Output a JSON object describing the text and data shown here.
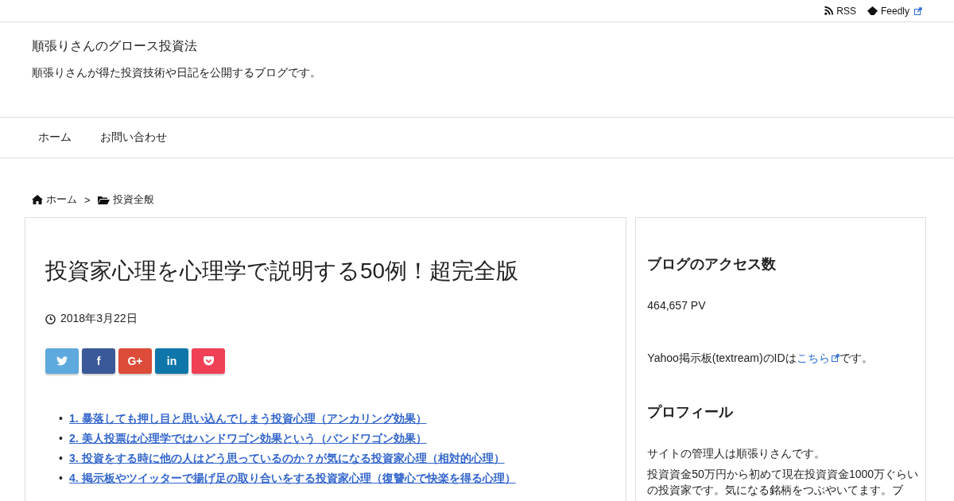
{
  "top_links": [
    {
      "kind": "rss",
      "label": "RSS",
      "external": false
    },
    {
      "kind": "feedly",
      "label": "Feedly",
      "external": true
    }
  ],
  "site": {
    "title": "順張りさんのグロース投資法",
    "tagline": "順張りさんが得た投資技術や日記を公開するブログです。"
  },
  "nav": [
    "ホーム",
    "お問い合わせ"
  ],
  "breadcrumb": [
    {
      "kind": "home",
      "label": "ホーム"
    },
    {
      "kind": "folder",
      "label": "投資全般"
    }
  ],
  "breadcrumb_separator": ">",
  "article": {
    "title": "投資家心理を心理学で説明する50例！超完全版",
    "date": "2018年3月22日",
    "share": [
      {
        "kind": "twitter",
        "color": "#5ea9dd"
      },
      {
        "kind": "text",
        "label": "f",
        "color": "#3b5998"
      },
      {
        "kind": "text",
        "label": "G+",
        "color": "#dd4b39"
      },
      {
        "kind": "text",
        "label": "in",
        "color": "#0e76a8"
      },
      {
        "kind": "pocket",
        "color": "#ef4056"
      }
    ],
    "toc": [
      "1. 暴落しても押し目と思い込んでしまう投資心理（アンカリング効果）",
      "2. 美人投票は心理学ではハンドワゴン効果という（バンドワゴン効果）",
      "3. 投資をする時に他の人はどう思っているのか？が気になる投資家心理（相対的心理）",
      "4. 掲示板やツイッターで揚げ足の取り合いをする投資家心理（復讐心で快楽を得る心理）"
    ],
    "bullet": "•"
  },
  "sidebar": [
    {
      "heading": "ブログのアクセス数",
      "paragraphs": [
        {
          "text": "464,657 PV"
        },
        {
          "text": "Yahoo掲示板(textream)のIDは",
          "link": "こちら",
          "after": "です。"
        }
      ]
    },
    {
      "heading": "プロフィール",
      "paragraphs": [
        {
          "text": "サイトの管理人は順張りさんです。"
        },
        {
          "text": "投資資金50万円から初めて現在投資資金1000万ぐらいの投資家です。気になる銘柄をつぶやいてます。ブ"
        }
      ]
    }
  ]
}
